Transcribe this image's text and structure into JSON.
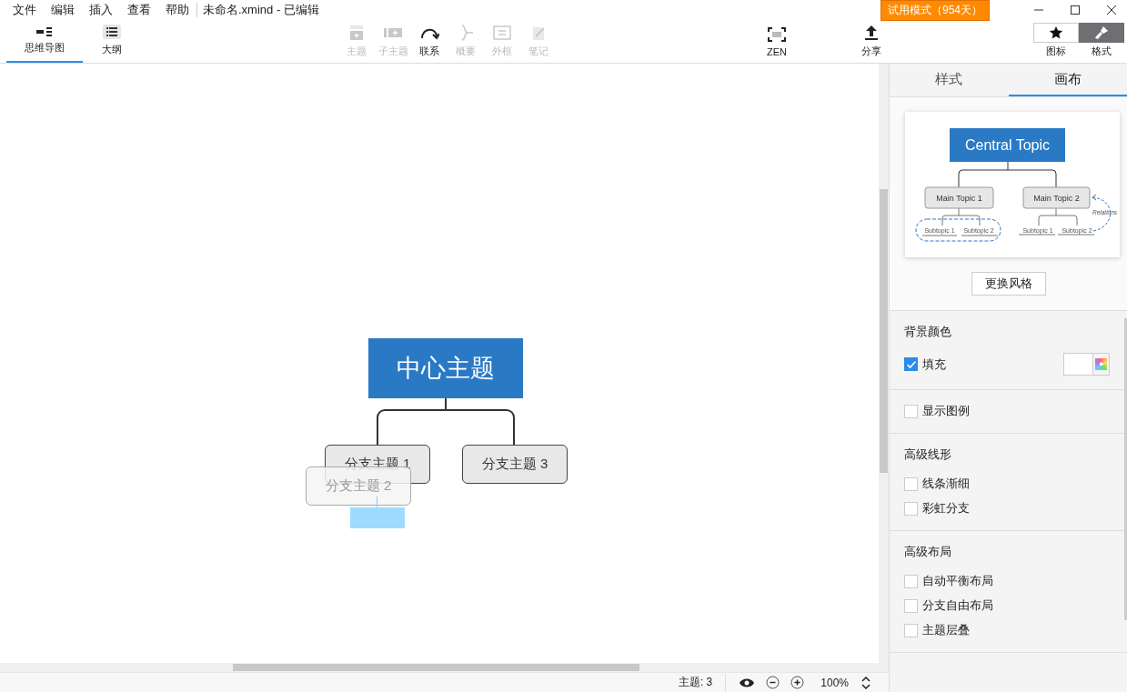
{
  "menu": [
    "文件",
    "编辑",
    "插入",
    "查看",
    "帮助"
  ],
  "document_title": "未命名.xmind - 已编辑",
  "trial_badge": "试用模式（954天）",
  "view_tabs": [
    {
      "label": "思维导图",
      "selected": true
    },
    {
      "label": "大纲",
      "selected": false
    }
  ],
  "tools": [
    {
      "label": "主题",
      "disabled": true
    },
    {
      "label": "子主题",
      "disabled": true
    },
    {
      "label": "联系",
      "disabled": false
    },
    {
      "label": "概要",
      "disabled": true
    },
    {
      "label": "外框",
      "disabled": true
    },
    {
      "label": "笔记",
      "disabled": true
    }
  ],
  "right_tools": [
    {
      "label": "ZEN"
    },
    {
      "label": "分享"
    }
  ],
  "panel_toggles": [
    {
      "label": "图标",
      "selected": false
    },
    {
      "label": "格式",
      "selected": true
    }
  ],
  "canvas": {
    "central_topic": "中心主题",
    "branches": [
      {
        "label": "分支主题 1",
        "kind": "left"
      },
      {
        "label": "分支主题 3",
        "kind": "right"
      }
    ],
    "dragging": {
      "label": "分支主题 2"
    }
  },
  "status_bar": {
    "topic_count": "主题: 3",
    "zoom": "100%"
  },
  "panel": {
    "tabs": [
      {
        "label": "样式",
        "selected": false
      },
      {
        "label": "画布",
        "selected": true
      }
    ],
    "preview": {
      "central": "Central Topic",
      "main": [
        "Main Topic 1",
        "Main Topic 2"
      ],
      "subtopics": [
        "Subtopic 1",
        "Subtopic 2",
        "Subtopic 1",
        "Subtopic 2"
      ],
      "relationship": "Relations"
    },
    "change_style_button": "更换风格",
    "sections": [
      {
        "title": "背景颜色",
        "options": [
          {
            "label": "填充",
            "checked": true,
            "kind": "color"
          }
        ]
      },
      {
        "options": [
          {
            "label": "显示图例",
            "checked": false,
            "kind": "plain"
          }
        ]
      },
      {
        "title": "高级线形",
        "options": [
          {
            "label": "线条渐细",
            "checked": false,
            "kind": "plain"
          },
          {
            "label": "彩虹分支",
            "checked": false,
            "kind": "plain"
          }
        ]
      },
      {
        "title": "高级布局",
        "options": [
          {
            "label": "自动平衡布局",
            "checked": false,
            "kind": "plain"
          },
          {
            "label": "分支自由布局",
            "checked": false,
            "kind": "plain"
          },
          {
            "label": "主题层叠",
            "checked": false,
            "kind": "plain"
          }
        ]
      }
    ]
  }
}
